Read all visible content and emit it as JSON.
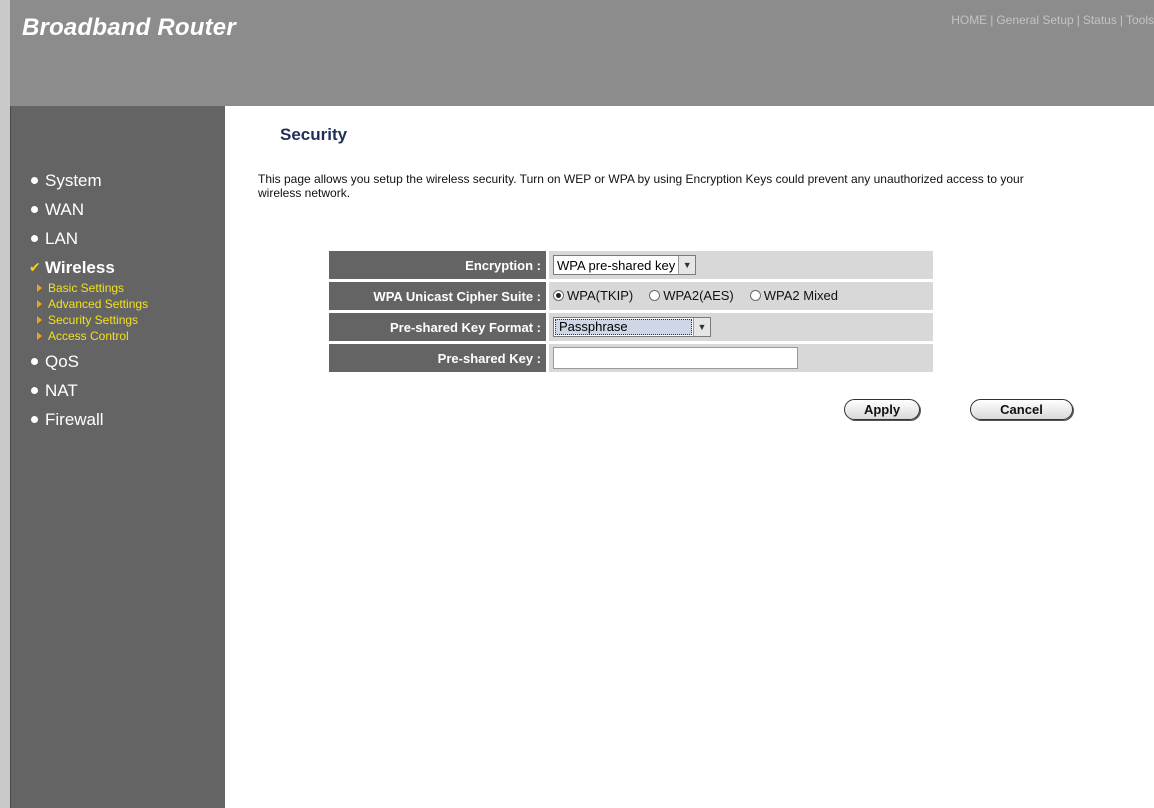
{
  "header": {
    "brand": "Broadband Router",
    "topnav": [
      "HOME",
      "General Setup",
      "Status",
      "Tools"
    ]
  },
  "sidebar": {
    "items": [
      {
        "label": "System"
      },
      {
        "label": "WAN"
      },
      {
        "label": "LAN"
      },
      {
        "label": "Wireless",
        "active": true
      },
      {
        "label": "QoS"
      },
      {
        "label": "NAT"
      },
      {
        "label": "Firewall"
      }
    ],
    "wireless_sub": [
      "Basic Settings",
      "Advanced Settings",
      "Security Settings",
      "Access Control"
    ]
  },
  "main": {
    "title": "Security",
    "intro": "This page allows you setup the wireless security. Turn on WEP or WPA by using Encryption Keys could prevent any unauthorized access to your wireless network.",
    "form": {
      "encryption_label": "Encryption :",
      "encryption_value": "WPA pre-shared key",
      "cipher_label": "WPA Unicast Cipher Suite :",
      "cipher_options": [
        "WPA(TKIP)",
        "WPA2(AES)",
        "WPA2 Mixed"
      ],
      "cipher_selected": "WPA(TKIP)",
      "format_label": "Pre-shared Key Format :",
      "format_value": "Passphrase",
      "key_label": "Pre-shared Key :",
      "key_value": ""
    },
    "buttons": {
      "apply": "Apply",
      "cancel": "Cancel"
    }
  },
  "colors": {
    "header_bg": "#8c8c8c",
    "sidebar_bg": "#646464",
    "sub_nav": "#f2e020",
    "title": "#1f2f5a"
  }
}
